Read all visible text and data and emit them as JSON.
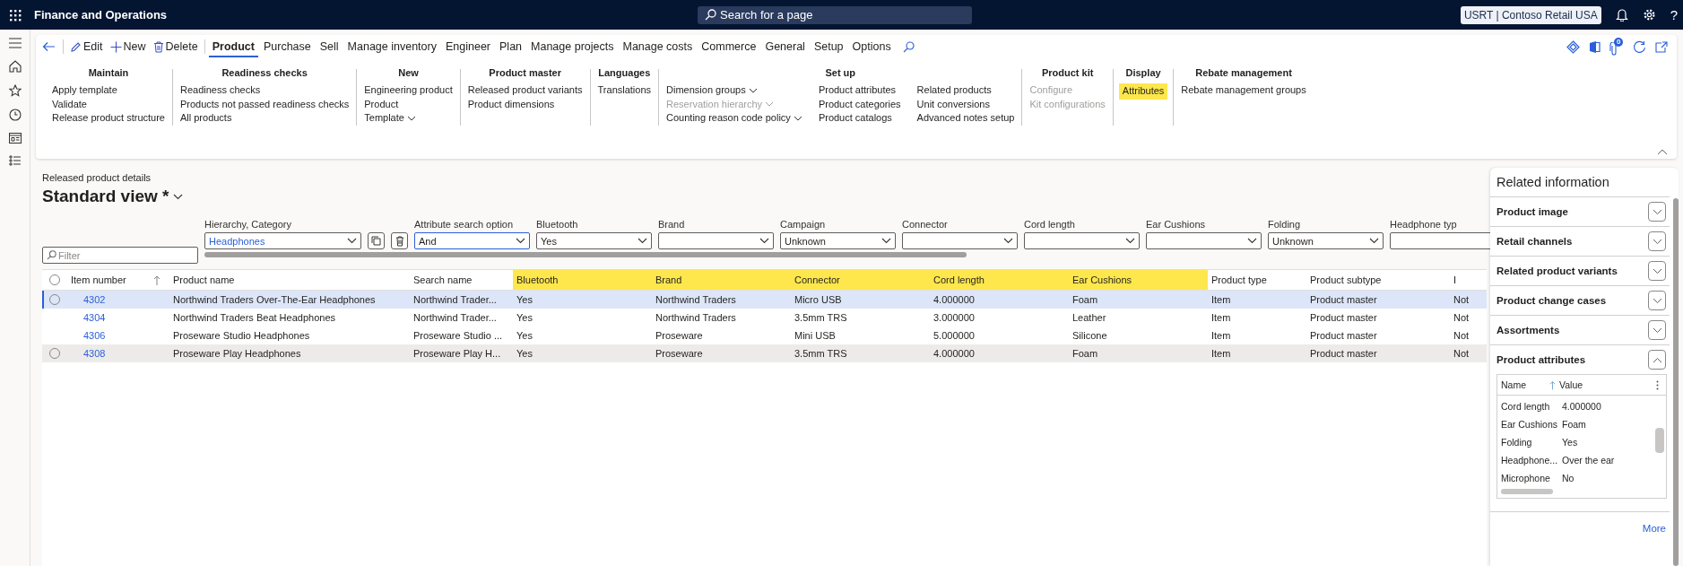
{
  "top_bar": {
    "app_title": "Finance and Operations",
    "search": {
      "placeholder": "Search for a page"
    },
    "company": "USRT | Contoso Retail USA",
    "help": "?"
  },
  "action_pane": {
    "buttons": [
      {
        "kind": "edit",
        "label": "Edit"
      },
      {
        "kind": "new",
        "label": "New"
      },
      {
        "kind": "delete",
        "label": "Delete"
      }
    ],
    "tabs": [
      {
        "label": "Product",
        "selected": true
      },
      {
        "label": "Purchase",
        "selected": false
      },
      {
        "label": "Sell",
        "selected": false
      },
      {
        "label": "Manage inventory",
        "selected": false
      },
      {
        "label": "Engineer",
        "selected": false
      },
      {
        "label": "Plan",
        "selected": false
      },
      {
        "label": "Manage projects",
        "selected": false
      },
      {
        "label": "Manage costs",
        "selected": false
      },
      {
        "label": "Commerce",
        "selected": false
      },
      {
        "label": "General",
        "selected": false
      },
      {
        "label": "Setup",
        "selected": false
      },
      {
        "label": "Options",
        "selected": false
      }
    ],
    "attachments_count": "0",
    "groups": [
      {
        "header": "Maintain",
        "columns": [
          [
            {
              "label": "Apply template",
              "kind": "command",
              "disabled": false,
              "on": false
            },
            {
              "label": "Validate",
              "kind": "command",
              "disabled": false,
              "on": false
            },
            {
              "label": "Release product structure",
              "kind": "command",
              "disabled": false,
              "on": false
            }
          ]
        ]
      },
      {
        "header": "Readiness checks",
        "columns": [
          [
            {
              "label": "Readiness checks",
              "kind": "command",
              "disabled": false,
              "on": false
            },
            {
              "label": "Products not passed readiness checks",
              "kind": "command",
              "disabled": false,
              "on": false
            },
            {
              "label": "All products",
              "kind": "command",
              "disabled": false,
              "on": false
            }
          ]
        ]
      },
      {
        "header": "New",
        "columns": [
          [
            {
              "label": "Engineering product",
              "kind": "command",
              "disabled": false,
              "on": false
            },
            {
              "label": "Product",
              "kind": "command",
              "disabled": false,
              "on": false
            },
            {
              "label": "Template",
              "kind": "menu",
              "disabled": false,
              "on": false
            }
          ]
        ]
      },
      {
        "header": "Product master",
        "columns": [
          [
            {
              "label": "Released product variants",
              "kind": "command",
              "disabled": false,
              "on": false
            },
            {
              "label": "Product dimensions",
              "kind": "command",
              "disabled": false,
              "on": false
            }
          ]
        ]
      },
      {
        "header": "Languages",
        "columns": [
          [
            {
              "label": "Translations",
              "kind": "command",
              "disabled": false,
              "on": false
            }
          ]
        ]
      },
      {
        "header": "Set up",
        "columns": [
          [
            {
              "label": "Dimension groups",
              "kind": "menu",
              "disabled": false,
              "on": false
            },
            {
              "label": "Reservation hierarchy",
              "kind": "menu",
              "disabled": true,
              "on": false
            },
            {
              "label": "Counting reason code policy",
              "kind": "menu",
              "disabled": false,
              "on": false
            }
          ],
          [
            {
              "label": "Product attributes",
              "kind": "command",
              "disabled": false,
              "on": false
            },
            {
              "label": "Product categories",
              "kind": "command",
              "disabled": false,
              "on": false
            },
            {
              "label": "Product catalogs",
              "kind": "command",
              "disabled": false,
              "on": false
            }
          ],
          [
            {
              "label": "Related products",
              "kind": "command",
              "disabled": false,
              "on": false
            },
            {
              "label": "Unit conversions",
              "kind": "command",
              "disabled": false,
              "on": false
            },
            {
              "label": "Advanced notes setup",
              "kind": "command",
              "disabled": false,
              "on": false
            }
          ]
        ]
      },
      {
        "header": "Product kit",
        "columns": [
          [
            {
              "label": "Configure",
              "kind": "command",
              "disabled": true,
              "on": false
            },
            {
              "label": "Kit configurations",
              "kind": "command",
              "disabled": true,
              "on": false
            }
          ]
        ]
      },
      {
        "header": "Display",
        "columns": [
          [
            {
              "label": "Attributes",
              "kind": "command",
              "disabled": false,
              "on": true
            }
          ]
        ]
      },
      {
        "header": "Rebate management",
        "columns": [
          [
            {
              "label": "Rebate management groups",
              "kind": "command",
              "disabled": false,
              "on": false
            }
          ]
        ]
      }
    ]
  },
  "page": {
    "caption": "Released product details",
    "view_title": "Standard view *"
  },
  "filters": {
    "quick_filter": {
      "placeholder": "Filter"
    },
    "fields": [
      {
        "label": "Hierarchy, Category",
        "value": "Headphones",
        "kind": "hierarchy",
        "focused": false
      },
      {
        "label": "Attribute search option",
        "value": "And",
        "kind": "combo",
        "focused": true
      },
      {
        "label": "Bluetooth",
        "value": "Yes",
        "kind": "combo",
        "focused": false
      },
      {
        "label": "Brand",
        "kind": "combo",
        "focused": false
      },
      {
        "label": "Campaign",
        "value": "Unknown",
        "kind": "combo",
        "focused": false
      },
      {
        "label": "Connector",
        "kind": "combo",
        "focused": false
      },
      {
        "label": "Cord length",
        "kind": "combo",
        "focused": false
      },
      {
        "label": "Ear Cushions",
        "kind": "combo",
        "focused": false
      },
      {
        "label": "Folding",
        "value": "Unknown",
        "kind": "combo",
        "focused": false
      },
      {
        "label": "Headphone typ",
        "kind": "partial",
        "focused": false
      }
    ]
  },
  "grid": {
    "select_all": {
      "checked": false
    },
    "columns": [
      {
        "label": "Item number",
        "sorted": true,
        "highlighted": false
      },
      {
        "label": "Product name",
        "sorted": false,
        "highlighted": false
      },
      {
        "label": "Search name",
        "sorted": false,
        "highlighted": false
      },
      {
        "label": "Bluetooth",
        "sorted": false,
        "highlighted": true
      },
      {
        "label": "Brand",
        "sorted": false,
        "highlighted": true
      },
      {
        "label": "Connector",
        "sorted": false,
        "highlighted": true
      },
      {
        "label": "Cord length",
        "sorted": false,
        "highlighted": true
      },
      {
        "label": "Ear Cushions",
        "sorted": false,
        "highlighted": true
      },
      {
        "label": "Product type",
        "sorted": false,
        "highlighted": false
      },
      {
        "label": "Product subtype",
        "sorted": false,
        "highlighted": false
      },
      {
        "label": "I",
        "sorted": false,
        "highlighted": false
      }
    ],
    "rows": [
      {
        "selected": true,
        "hovered": false,
        "cells": [
          "4302",
          "Northwind Traders Over-The-Ear Headphones",
          "Northwind Trader...",
          "Yes",
          "Northwind Traders",
          "Micro USB",
          "4.000000",
          "Foam",
          "Item",
          "Product master",
          "Not"
        ]
      },
      {
        "selected": false,
        "hovered": false,
        "cells": [
          "4304",
          "Northwind Traders Beat Headphones",
          "Northwind Trader...",
          "Yes",
          "Northwind Traders",
          "3.5mm TRS",
          "3.000000",
          "Leather",
          "Item",
          "Product master",
          "Not"
        ]
      },
      {
        "selected": false,
        "hovered": false,
        "cells": [
          "4306",
          "Proseware Studio Headphones",
          "Proseware Studio ...",
          "Yes",
          "Proseware",
          "Mini USB",
          "5.000000",
          "Silicone",
          "Item",
          "Product master",
          "Not"
        ]
      },
      {
        "selected": false,
        "hovered": true,
        "cells": [
          "4308",
          "Proseware Play Headphones",
          "Proseware Play H...",
          "Yes",
          "Proseware",
          "3.5mm TRS",
          "4.000000",
          "Foam",
          "Item",
          "Product master",
          "Not"
        ]
      }
    ]
  },
  "related_information": {
    "title": "Related information",
    "sections": [
      {
        "title": "Product image",
        "expanded": false
      },
      {
        "title": "Retail channels",
        "expanded": false
      },
      {
        "title": "Related product variants",
        "expanded": false
      },
      {
        "title": "Product change cases",
        "expanded": false
      },
      {
        "title": "Assortments",
        "expanded": false
      },
      {
        "title": "Product attributes",
        "expanded": true
      }
    ],
    "attributes": {
      "columns": [
        {
          "label": "Name",
          "sorted": true
        },
        {
          "label": "Value",
          "sorted": false
        }
      ],
      "rows": [
        [
          "Cord length",
          "4.000000"
        ],
        [
          "Ear Cushions",
          "Foam"
        ],
        [
          "Folding",
          "Yes"
        ],
        [
          "Headphone...",
          "Over the ear"
        ],
        [
          "Microphone",
          "No"
        ]
      ]
    },
    "more_link": "More"
  }
}
